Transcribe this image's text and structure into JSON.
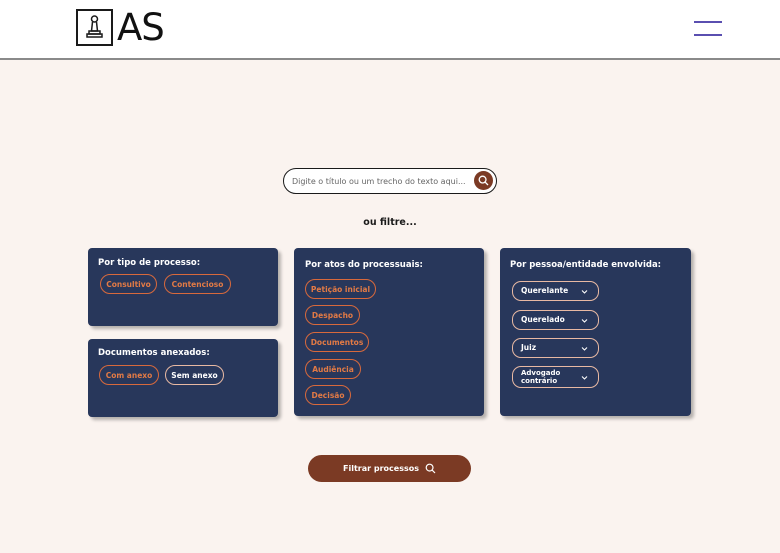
{
  "header": {
    "logo_text": "AS",
    "logo_icon": "chess-pawn-icon",
    "menu_icon": "hamburger-menu-icon"
  },
  "search": {
    "placeholder": "Digite o título ou um trecho do texto aqui...",
    "icon": "search-icon"
  },
  "or_filter": "ou filtre...",
  "filters": {
    "process_type": {
      "title": "Por tipo de processo:",
      "options": [
        "Consultivo",
        "Contencioso"
      ]
    },
    "attachments": {
      "title": "Documentos anexados:",
      "options": [
        "Com anexo",
        "Sem anexo"
      ]
    },
    "procedural_acts": {
      "title": "Por atos do processuais:",
      "options": [
        "Petição inicial",
        "Despacho",
        "Documentos",
        "Audiência",
        "Decisão"
      ]
    },
    "person_entity": {
      "title": "Por pessoa/entidade envolvida:",
      "dropdowns": [
        "Querelante",
        "Querelado",
        "Juiz",
        "Advogado contrário"
      ]
    }
  },
  "filter_button": {
    "label": "Filtrar processos",
    "icon": "search-icon"
  },
  "colors": {
    "background": "#faf3ef",
    "card": "#28375b",
    "accent": "#7b3a24",
    "chip_orange": "#e27a45",
    "menu": "#5a4fb0"
  }
}
